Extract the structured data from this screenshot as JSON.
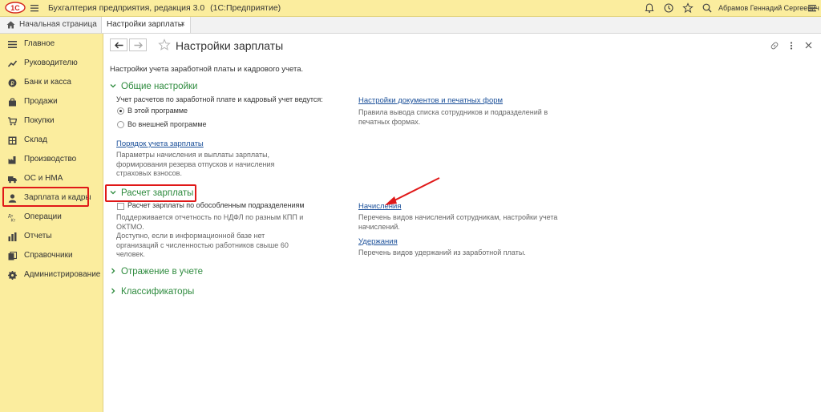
{
  "titlebar": {
    "logo_text": "1С",
    "app_title": "Бухгалтерия предприятия, редакция 3.0",
    "app_platform": "(1С:Предприятие)",
    "user": "Абрамов Геннадий Сергеевич"
  },
  "tabs": {
    "home": "Начальная страница",
    "active": "Настройки зарплаты",
    "close_glyph": "×"
  },
  "sidebar": {
    "items": [
      {
        "label": "Главное",
        "icon": "menu-lines-icon"
      },
      {
        "label": "Руководителю",
        "icon": "trend-icon"
      },
      {
        "label": "Банк и касса",
        "icon": "coin-icon"
      },
      {
        "label": "Продажи",
        "icon": "bag-icon"
      },
      {
        "label": "Покупки",
        "icon": "cart-icon"
      },
      {
        "label": "Склад",
        "icon": "warehouse-icon"
      },
      {
        "label": "Производство",
        "icon": "factory-icon"
      },
      {
        "label": "ОС и НМА",
        "icon": "truck-icon"
      },
      {
        "label": "Зарплата и кадры",
        "icon": "person-icon"
      },
      {
        "label": "Операции",
        "icon": "operations-icon"
      },
      {
        "label": "Отчеты",
        "icon": "bar-chart-icon"
      },
      {
        "label": "Справочники",
        "icon": "books-icon"
      },
      {
        "label": "Администрирование",
        "icon": "gear-icon"
      }
    ],
    "highlight_color": "#e01818"
  },
  "main": {
    "title": "Настройки зарплаты",
    "subtitle": "Настройки учета заработной платы и кадрового учета.",
    "general": {
      "header": "Общие настройки",
      "question": "Учет расчетов по заработной плате и кадровый учет ведутся:",
      "radio_in": "В этой программе",
      "radio_out": "Во внешней программе",
      "order_link": "Порядок учета зарплаты",
      "order_desc_1": "Параметры начисления и выплаты зарплаты,",
      "order_desc_2": "формирования резерва отпусков и начисления",
      "order_desc_3": "страховых взносов.",
      "docs_link": "Настройки документов и печатных форм",
      "docs_desc_1": "Правила вывода списка сотрудников и подразделений в",
      "docs_desc_2": "печатных формах."
    },
    "payroll": {
      "header": "Расчет зарплаты",
      "checkbox_label": "Расчет зарплаты по обособленным подразделениям",
      "desc_1": "Поддерживается отчетность по НДФЛ по разным КПП и",
      "desc_2": "ОКТМО.",
      "desc_3": "Доступно, если в информационной базе нет",
      "desc_4": "организаций с численностью работников свыше 60",
      "desc_5": "человек.",
      "accruals_link": "Начисления",
      "accruals_desc_1": "Перечень видов начислений сотрудникам, настройки учета",
      "accruals_desc_2": "начислений.",
      "deductions_link": "Удержания",
      "deductions_desc": "Перечень видов удержаний из заработной платы."
    },
    "reflection_header": "Отражение в учете",
    "classifiers_header": "Классификаторы",
    "accent_color": "#2e8b3e",
    "link_color": "#1a4f99"
  }
}
